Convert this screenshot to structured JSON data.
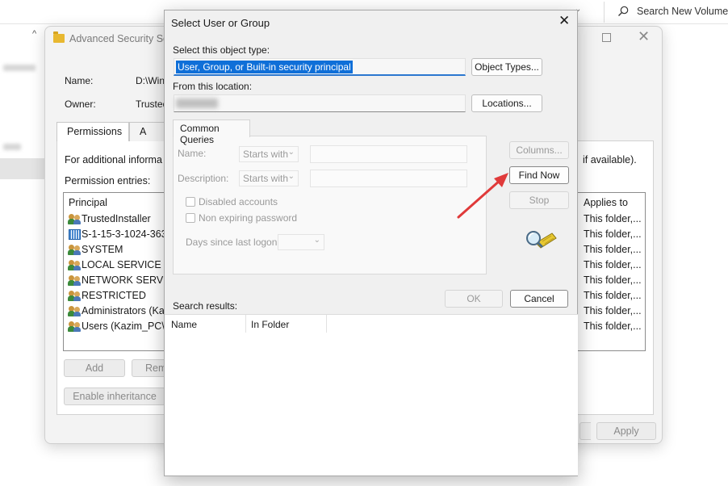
{
  "top_search": {
    "placeholder": "Search New Volume ("
  },
  "adv_window": {
    "title": "Advanced Security Set",
    "name_label": "Name:",
    "name_value": "D:\\Win",
    "owner_label": "Owner:",
    "owner_value": "Trusted",
    "tabs": [
      {
        "label": "Permissions"
      },
      {
        "label": "A"
      }
    ],
    "info_text": "For additional informa",
    "info_text_right": "if available).",
    "permission_entries_label": "Permission entries:",
    "columns": {
      "principal": "Principal",
      "applies_to": "Applies to"
    },
    "entries": [
      {
        "principal": "TrustedInstaller",
        "applies": "This folder,...",
        "icon": "group-icon"
      },
      {
        "principal": "S-1-15-3-1024-363",
        "applies": "This folder,...",
        "icon": "sid-icon"
      },
      {
        "principal": "SYSTEM",
        "applies": "This folder,...",
        "icon": "group-icon"
      },
      {
        "principal": "LOCAL SERVICE",
        "applies": "This folder,...",
        "icon": "group-icon"
      },
      {
        "principal": "NETWORK SERVICI",
        "applies": "This folder,...",
        "icon": "group-icon"
      },
      {
        "principal": "RESTRICTED",
        "applies": "This folder,...",
        "icon": "group-icon"
      },
      {
        "principal": "Administrators (Ka",
        "applies": "This folder,...",
        "icon": "group-icon"
      },
      {
        "principal": "Users (Kazim_PC\\Us",
        "applies": "This folder,...",
        "icon": "group-icon"
      }
    ],
    "buttons": {
      "add": "Add",
      "remove": "Rem",
      "enable_inheritance": "Enable inheritance",
      "apply": "Apply"
    }
  },
  "dialog": {
    "title": "Select User or Group",
    "object_type_label": "Select this object type:",
    "object_type_value": "User, Group, or Built-in security principal",
    "object_types_button": "Object Types...",
    "location_label": "From this location:",
    "locations_button": "Locations...",
    "common_queries_tab": "Common Queries",
    "name_label": "Name:",
    "name_mode": "Starts with",
    "description_label": "Description:",
    "description_mode": "Starts with",
    "disabled_accounts": "Disabled accounts",
    "non_expiring_password": "Non expiring password",
    "days_since_logon": "Days since last logon:",
    "columns_button": "Columns...",
    "find_now_button": "Find Now",
    "stop_button": "Stop",
    "ok_button": "OK",
    "cancel_button": "Cancel",
    "search_results_label": "Search results:",
    "result_columns": {
      "name": "Name",
      "in_folder": "In Folder"
    }
  },
  "colors": {
    "accent": "#0f6fd8",
    "annotation_arrow": "#e03a3a"
  }
}
